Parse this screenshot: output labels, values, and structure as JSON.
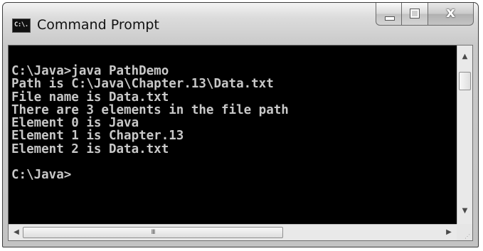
{
  "window": {
    "title": "Command Prompt",
    "icon_label": "C:\\.",
    "icon": "console-window-icon",
    "buttons": {
      "minimize_icon": "minimize-icon",
      "maximize_icon": "maximize-icon",
      "close_icon": "close-icon",
      "close_glyph": "x"
    }
  },
  "console": {
    "background": "#000000",
    "foreground": "#c8c8c8",
    "lines": [
      "C:\\Java>java PathDemo",
      "Path is C:\\Java\\Chapter.13\\Data.txt",
      "File name is Data.txt",
      "There are 3 elements in the file path",
      "Element 0 is Java",
      "Element 1 is Chapter.13",
      "Element 2 is Data.txt",
      "",
      "C:\\Java>"
    ]
  },
  "scrollbars": {
    "up_arrow": "▲",
    "down_arrow": "▼",
    "left_arrow": "◀",
    "right_arrow": "▶",
    "thumb_grip": "III",
    "resize_grip": "⋰"
  }
}
